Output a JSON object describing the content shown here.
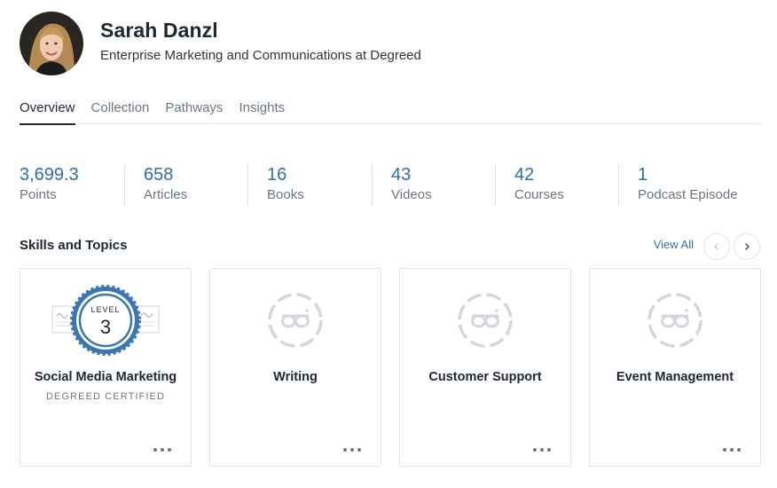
{
  "profile": {
    "name": "Sarah Danzl",
    "headline": "Enterprise Marketing and Communications at Degreed"
  },
  "tabs": [
    {
      "label": "Overview",
      "active": true
    },
    {
      "label": "Collection",
      "active": false
    },
    {
      "label": "Pathways",
      "active": false
    },
    {
      "label": "Insights",
      "active": false
    }
  ],
  "stats": [
    {
      "value": "3,699.3",
      "label": "Points"
    },
    {
      "value": "658",
      "label": "Articles"
    },
    {
      "value": "16",
      "label": "Books"
    },
    {
      "value": "43",
      "label": "Videos"
    },
    {
      "value": "42",
      "label": "Courses"
    },
    {
      "value": "1",
      "label": "Podcast Episode"
    }
  ],
  "skills": {
    "title": "Skills and Topics",
    "view_all": "View All",
    "prev_icon": "chevron-left-icon",
    "next_icon": "chevron-right-icon",
    "cards": [
      {
        "title": "Social Media Marketing",
        "subtitle": "DEGREED CERTIFIED",
        "badge": "level-certified-badge",
        "level_label": "LEVEL",
        "level": "3"
      },
      {
        "title": "Writing",
        "subtitle": "",
        "badge": "glasses-placeholder-icon"
      },
      {
        "title": "Customer Support",
        "subtitle": "",
        "badge": "glasses-placeholder-icon"
      },
      {
        "title": "Event Management",
        "subtitle": "",
        "badge": "glasses-placeholder-icon"
      }
    ]
  },
  "colors": {
    "accent": "#2f6ea8",
    "badge_blue": "#3a77b0",
    "placeholder_gray": "#d3d7dc"
  }
}
